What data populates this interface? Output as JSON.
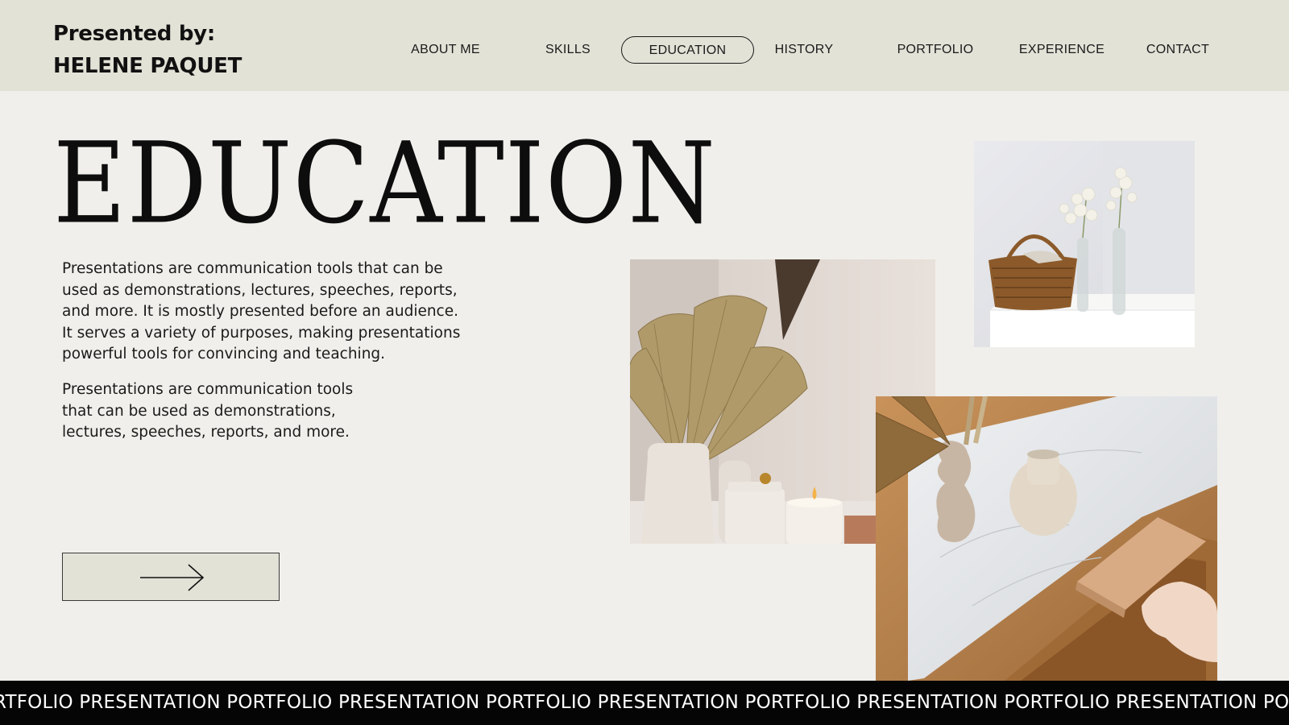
{
  "presenter": {
    "line1": "Presented by:",
    "line2": "HELENE PAQUET"
  },
  "nav": {
    "items": [
      {
        "label": "ABOUT ME"
      },
      {
        "label": "SKILLS"
      },
      {
        "label": "EDUCATION",
        "active": true
      },
      {
        "label": "HISTORY"
      },
      {
        "label": "PORTFOLIO"
      },
      {
        "label": "EXPERIENCE"
      },
      {
        "label": "CONTACT"
      }
    ]
  },
  "main": {
    "title": "EDUCATION",
    "paragraph1": "Presentations are communication tools that can be used as demonstrations, lectures, speeches, reports, and more. It is mostly presented before an audience. It serves a variety of purposes, making presentations powerful tools for convincing and teaching.",
    "paragraph2": "Presentations are communication tools that can be used as demonstrations, lectures, speeches, reports, and more.",
    "next_button_icon": "arrow-right-icon"
  },
  "ticker": {
    "text": "RTFOLIO PRESENTATION PORTFOLIO PRESENTATION PORTFOLIO PRESENTATION PORTFOLIO PRESENTATION PORTFOLIO PRESENTATION PORTFOLIO PRESENTA"
  },
  "colors": {
    "background": "#f0efeb",
    "header": "#e3e2d7",
    "ticker": "#050505",
    "text": "#141414"
  }
}
